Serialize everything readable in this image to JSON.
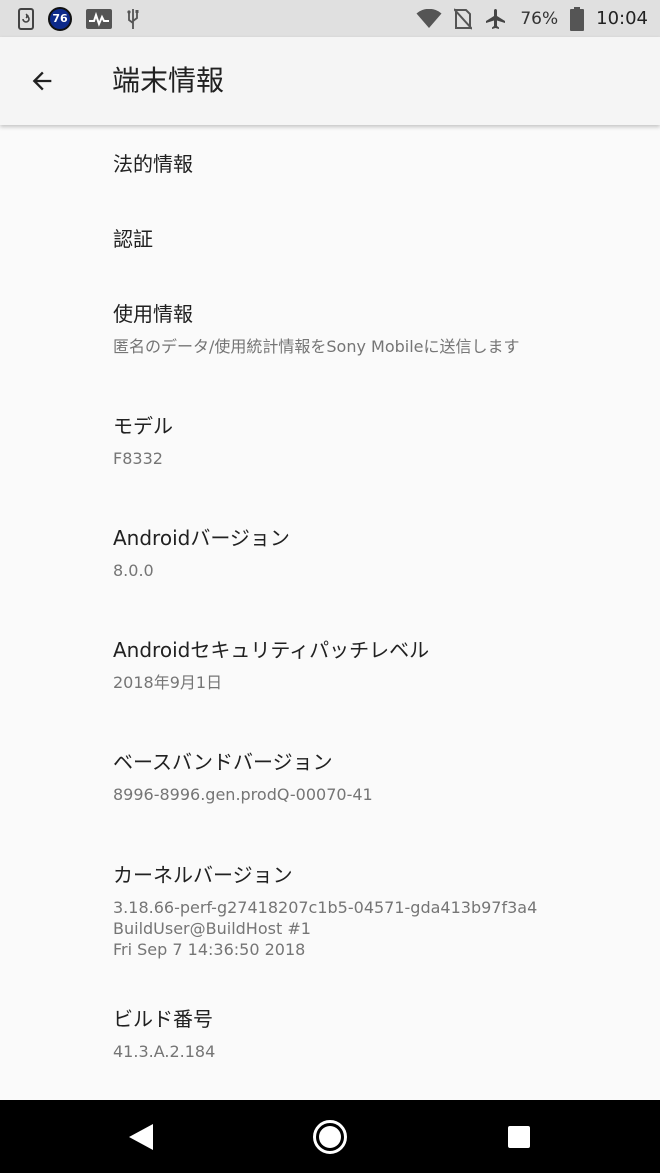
{
  "status_bar": {
    "notification_badge": "76",
    "battery_percent": "76%",
    "time": "10:04",
    "icons": [
      "sync-icon",
      "activity-icon",
      "usb-icon",
      "wifi-icon",
      "no-sim-icon",
      "airplane-icon",
      "battery-icon"
    ]
  },
  "app_bar": {
    "title": "端末情報",
    "back_icon": "arrow-back-icon"
  },
  "items": [
    {
      "title": "法的情報"
    },
    {
      "title": "認証"
    },
    {
      "title": "使用情報",
      "subtitle": "匿名のデータ/使用統計情報をSony Mobileに送信します"
    },
    {
      "title": "モデル",
      "subtitle": "F8332"
    },
    {
      "title": "Androidバージョン",
      "subtitle": "8.0.0"
    },
    {
      "title": "Androidセキュリティパッチレベル",
      "subtitle": "2018年9月1日"
    },
    {
      "title": "ベースバンドバージョン",
      "subtitle": "8996-8996.gen.prodQ-00070-41"
    },
    {
      "title": "カーネルバージョン",
      "subtitle_lines": [
        "3.18.66-perf-g27418207c1b5-04571-gda413b97f3a4",
        "BuildUser@BuildHost #1",
        "Fri Sep 7 14:36:50 2018"
      ]
    },
    {
      "title": "ビルド番号",
      "subtitle": "41.3.A.2.184"
    }
  ],
  "nav_bar": {
    "icons": [
      "nav-back-icon",
      "nav-home-icon",
      "nav-recents-icon"
    ]
  }
}
